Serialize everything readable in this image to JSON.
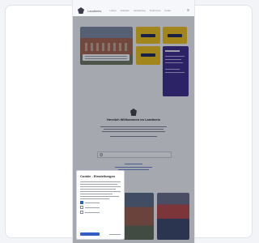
{
  "brand": {
    "name": "Landkreis"
  },
  "nav": {
    "items": [
      "Leben",
      "Arbeiten",
      "Verwaltung",
      "Tourismus",
      "Kultur"
    ]
  },
  "hero": {
    "tiles": [
      "building-photo",
      "info-tile-1",
      "info-tile-2",
      "info-tile-3",
      "event-panel"
    ]
  },
  "welcome": {
    "title": "Herzlich Willkommen im Landkreis"
  },
  "search": {
    "placeholder": ""
  },
  "cookie_banner": {
    "title": "Cookie - Einstellungen"
  },
  "colors": {
    "accent": "#2f5ec4",
    "brand_yellow": "#f0c21b",
    "purple": "#3e2c8c"
  }
}
